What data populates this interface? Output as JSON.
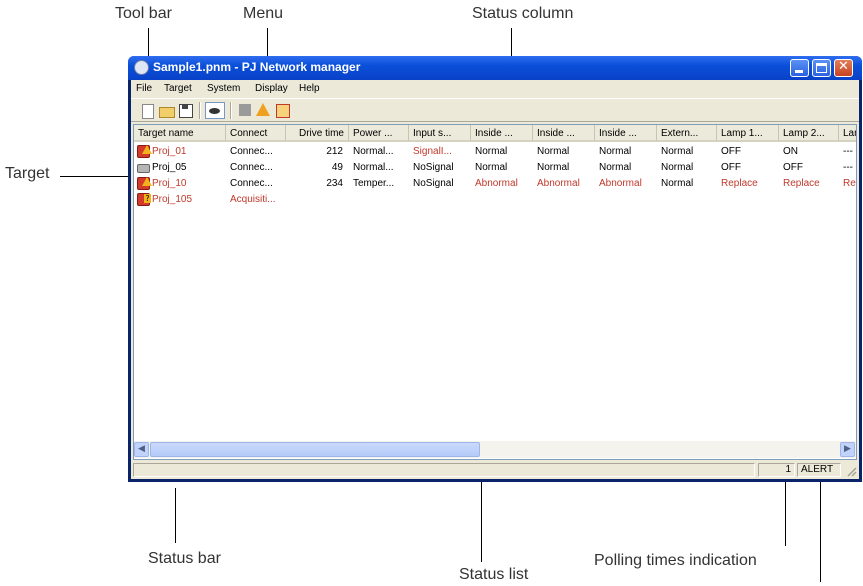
{
  "callouts": {
    "tool_bar": "Tool bar",
    "menu": "Menu",
    "status_column": "Status column",
    "target": "Target",
    "status_bar": "Status bar",
    "status_list": "Status list",
    "polling_times": "Polling times indication"
  },
  "window": {
    "title": "Sample1.pnm - PJ Network manager"
  },
  "menu": [
    "File",
    "Target",
    "System",
    "Display",
    "Help"
  ],
  "toolbar": {
    "icons": [
      "new-file-icon",
      "open-folder-icon",
      "save-disk-icon",
      "monitor-eye-icon",
      "stop-square-icon",
      "alert-warning-icon",
      "alert-list-icon"
    ]
  },
  "list": {
    "columns": [
      "Target name",
      "Connect",
      "Drive time",
      "Power ...",
      "Input s...",
      "Inside ...",
      "Inside ...",
      "Inside ...",
      "Extern...",
      "Lamp 1...",
      "Lamp 2...",
      "Lam"
    ],
    "rows": [
      {
        "icon": "alert-projector-icon",
        "name_color": "#c0392b",
        "cells": [
          "Proj_01",
          "Connec...",
          "212",
          "Normal...",
          "SignalI...",
          "Normal",
          "Normal",
          "Normal",
          "Normal",
          "OFF",
          "ON",
          "---"
        ],
        "red": [
          0,
          4
        ]
      },
      {
        "icon": "projector-icon",
        "name_color": "#000000",
        "cells": [
          "Proj_05",
          "Connec...",
          "49",
          "Normal...",
          "NoSignal",
          "Normal",
          "Normal",
          "Normal",
          "Normal",
          "OFF",
          "OFF",
          "---"
        ],
        "red": []
      },
      {
        "icon": "alert-projector-icon",
        "name_color": "#c0392b",
        "cells": [
          "Proj_10",
          "Connec...",
          "234",
          "Temper...",
          "NoSignal",
          "Abnormal",
          "Abnormal",
          "Abnormal",
          "Normal",
          "Replace",
          "Replace",
          "Rep"
        ],
        "red": [
          0,
          5,
          6,
          7,
          9,
          10,
          11
        ]
      },
      {
        "icon": "unknown-projector-icon",
        "name_color": "#c0392b",
        "cells": [
          "Proj_105",
          "Acquisiti...",
          "",
          "",
          "",
          "",
          "",
          "",
          "",
          "",
          "",
          ""
        ],
        "red": [
          0,
          1
        ]
      }
    ]
  },
  "statusbar": {
    "polling_count": "1",
    "alert_label": "ALERT"
  },
  "colors": {
    "alert_red": "#c0392b"
  }
}
